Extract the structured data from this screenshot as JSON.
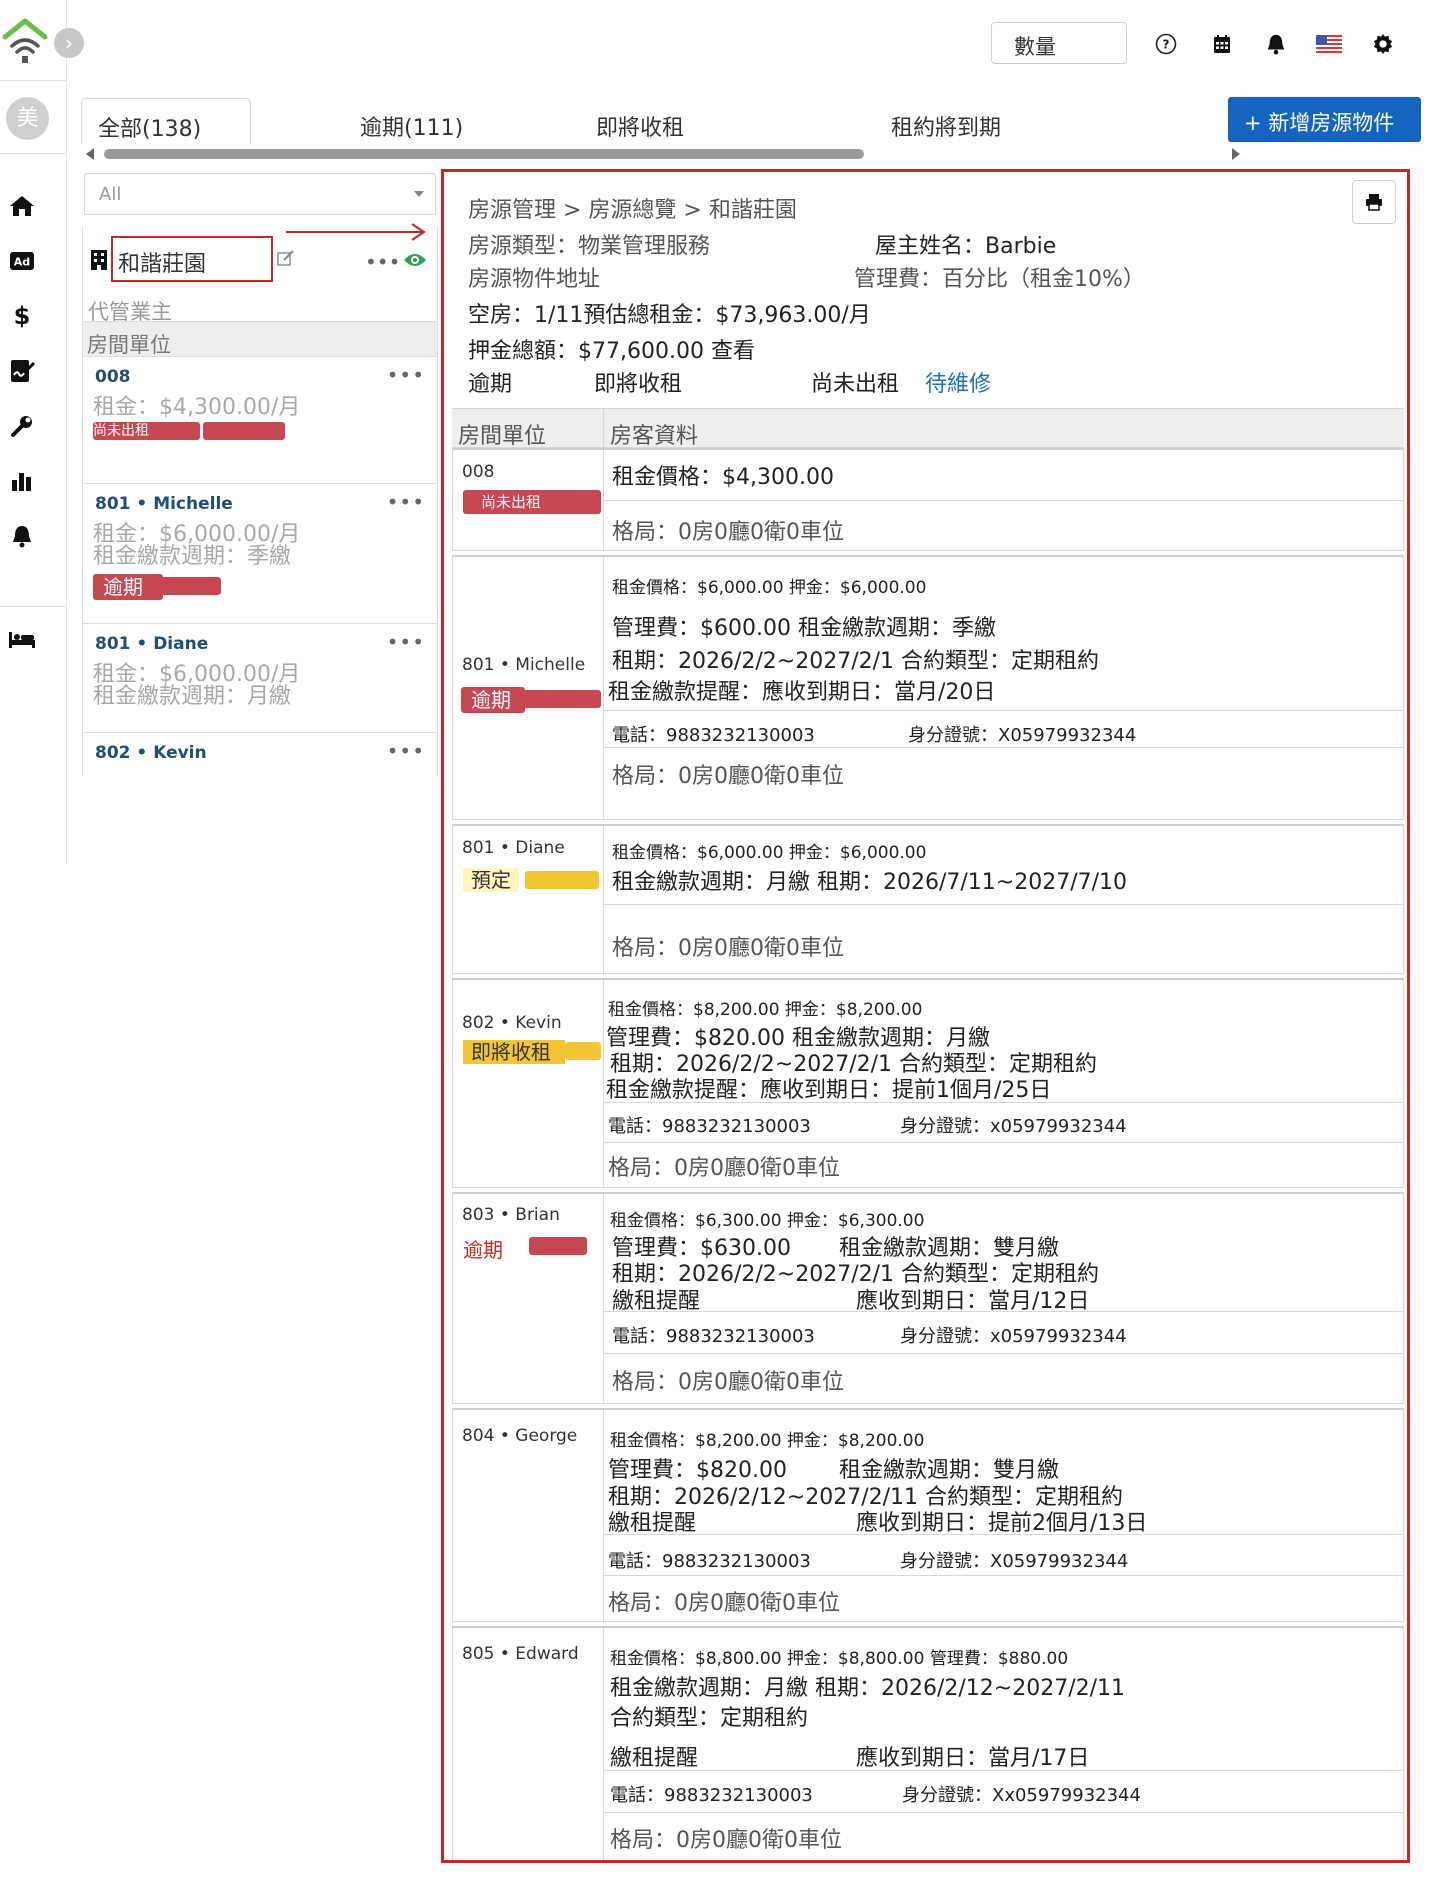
{
  "sidebar": {
    "avatar_text": "美",
    "icons": [
      "home-icon",
      "ad-icon",
      "dollar-icon",
      "signature-icon",
      "wrench-icon",
      "bar-chart-icon",
      "bell-icon",
      "bed-icon"
    ]
  },
  "topbar": {
    "quantity_label": "數量"
  },
  "tabs": [
    {
      "label": "全部(138)"
    },
    {
      "label": "逾期(111)"
    },
    {
      "label": "即將收租"
    },
    {
      "label": "租約將到期"
    }
  ],
  "add_button_label": "+ 新增房源物件",
  "list": {
    "filter_value": "All",
    "property_name": "和諧莊園",
    "owner_label": "代管業主",
    "header": "房間單位",
    "items": [
      {
        "unit": "008",
        "rent": "租金：$4,300.00/月",
        "cycle": "",
        "status": "尚未出租"
      },
      {
        "unit": "801 • Michelle",
        "rent": "租金：$6,000.00/月",
        "cycle": "租金繳款週期：季繳",
        "status": "逾期"
      },
      {
        "unit": "801 • Diane",
        "rent": "租金：$6,000.00/月",
        "cycle": "租金繳款週期：月繳",
        "status": ""
      },
      {
        "unit": "802 • Kevin",
        "rent": "",
        "cycle": "",
        "status": ""
      }
    ]
  },
  "detail": {
    "breadcrumb": "房源管理 > 房源總覽 > 和諧莊園",
    "property_type": "房源類型：物業管理服務",
    "owner_name": "屋主姓名：Barbie",
    "address_label": "房源物件地址",
    "mgmt_fee": "管理費：百分比（租金10%）",
    "vacancy": "空房：1/11預估總租金：$73,963.00/月",
    "deposit_total": "押金總額：$77,600.00 查看",
    "filters": [
      "逾期",
      "即將收租",
      "尚未出租",
      "待維修"
    ],
    "col_unit": "房間單位",
    "col_tenant": "房客資料",
    "rows": [
      {
        "unit": "008",
        "tag": "尚未出租",
        "lines": [
          "租金價格：$4,300.00"
        ],
        "layout": "格局：0房0廳0衛0車位"
      },
      {
        "unit": "801 • Michelle",
        "tag": "逾期",
        "lines": [
          "租金價格：$6,000.00   押金：$6,000.00",
          "管理費：$600.00 租金繳款週期：季繳",
          "租期：2026/2/2~2027/2/1 合約類型：定期租約",
          "租金繳款提醒：應收到期日：當月/20日"
        ],
        "phone": "電話：9883232130003",
        "id_no": "身分證號：X05979932344",
        "layout": "格局：0房0廳0衛0車位"
      },
      {
        "unit": "801 • Diane",
        "tag": "預定",
        "lines": [
          "租金價格：$6,000.00 押金：$6,000.00",
          "租金繳款週期：月繳 租期：2026/7/11~2027/7/10"
        ],
        "layout": "格局：0房0廳0衛0車位"
      },
      {
        "unit": "802 • Kevin",
        "tag": "即將收租",
        "lines": [
          "租金價格：$8,200.00 押金：$8,200.00",
          "管理費：$820.00 租金繳款週期：月繳",
          "租期：2026/2/2~2027/2/1 合約類型：定期租約",
          "租金繳款提醒：應收到期日：提前1個月/25日"
        ],
        "phone": "電話：9883232130003",
        "id_no": "身分證號：x05979932344",
        "layout": "格局：0房0廳0衛0車位"
      },
      {
        "unit": "803 • Brian",
        "tag": "逾期",
        "lines": [
          "租金價格：$6,300.00 押金：$6,300.00",
          "管理費：$630.00",
          "租金繳款週期：雙月繳",
          "租期：2026/2/2~2027/2/1 合約類型：定期租約",
          "繳租提醒",
          "應收到期日：當月/12日"
        ],
        "phone": "電話：9883232130003",
        "id_no": "身分證號：x05979932344",
        "layout": "格局：0房0廳0衛0車位"
      },
      {
        "unit": "804 • George",
        "tag": "",
        "lines": [
          "租金價格：$8,200.00 押金：$8,200.00",
          "管理費：$820.00",
          "租金繳款週期：雙月繳",
          "租期：2026/2/12~2027/2/11 合約類型：定期租約",
          "繳租提醒",
          "應收到期日：提前2個月/13日"
        ],
        "phone": "電話：9883232130003",
        "id_no": "身分證號：X05979932344",
        "layout": "格局：0房0廳0衛0車位"
      },
      {
        "unit": "805 • Edward",
        "tag": "",
        "lines": [
          "租金價格：$8,800.00 押金：$8,800.00 管理費：$880.00",
          "租金繳款週期：月繳 租期：2026/2/12~2027/2/11",
          "合約類型：定期租約",
          "繳租提醒",
          "應收到期日：當月/17日"
        ],
        "phone": "電話：9883232130003",
        "id_no": "身分證號：Xx05979932344",
        "layout": "格局：0房0廳0衛0車位"
      }
    ]
  },
  "colors": {
    "accent_blue": "#1565c0",
    "highlight_red": "#c62828",
    "tag_yellow": "#f2c633",
    "tag_pale_yellow": "#fff6bf",
    "logo_green": "#6abf4b"
  }
}
